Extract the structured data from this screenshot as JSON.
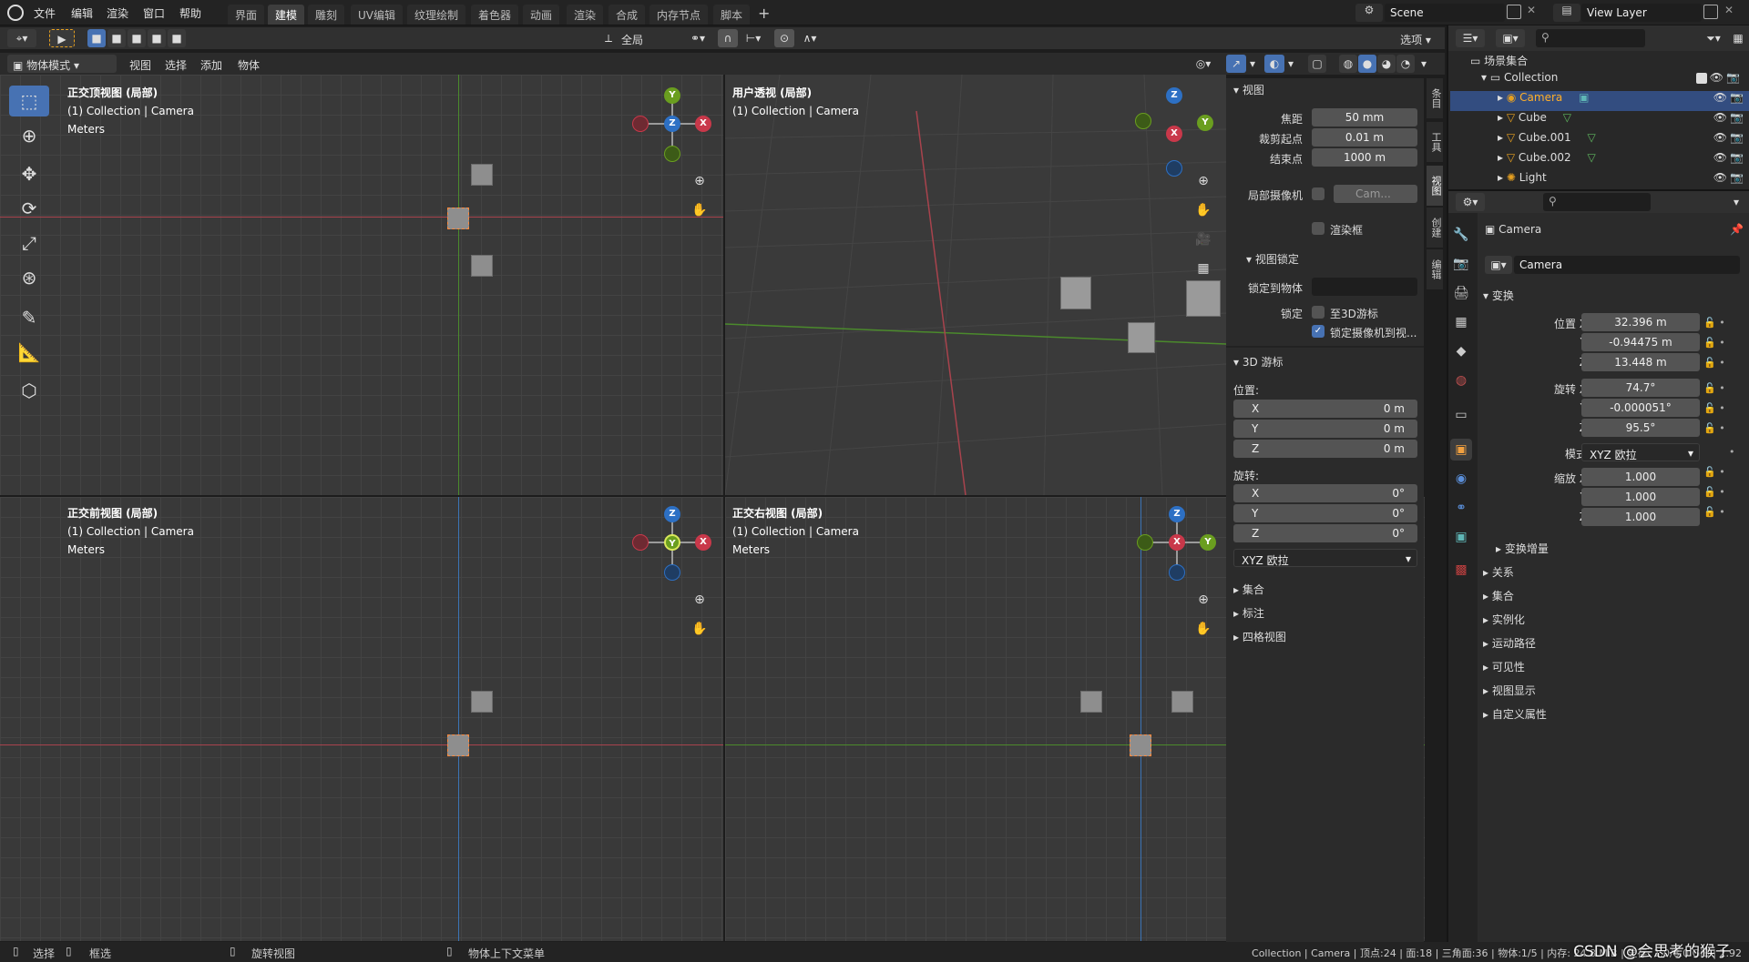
{
  "menu": {
    "items": [
      "文件",
      "编辑",
      "渲染",
      "窗口",
      "帮助"
    ]
  },
  "workspaces": [
    "界面",
    "建模",
    "雕刻",
    "UV编辑",
    "纹理绘制",
    "着色器",
    "动画",
    "渲染",
    "合成",
    "内存节点",
    "脚本"
  ],
  "workspace_add": "+",
  "scene": {
    "name": "Scene",
    "view_layer": "View Layer"
  },
  "viewport_header": {
    "mode": "物体模式",
    "menus": [
      "视图",
      "选择",
      "添加",
      "物体"
    ],
    "orientation": "全局",
    "options": "选项"
  },
  "viewports": {
    "top": {
      "title": "正交顶视图 (局部)",
      "collection": "(1) Collection | Camera",
      "units": "Meters"
    },
    "user": {
      "title": "用户透视 (局部)",
      "collection": "(1) Collection | Camera"
    },
    "front": {
      "title": "正交前视图 (局部)",
      "collection": "(1) Collection | Camera",
      "units": "Meters"
    },
    "right": {
      "title": "正交右视图 (局部)",
      "collection": "(1) Collection | Camera",
      "units": "Meters"
    }
  },
  "gizmo_labels": {
    "x": "X",
    "y": "Y",
    "z": "Z"
  },
  "npanel": {
    "view_header": "视图",
    "focal_label": "焦距",
    "focal_value": "50 mm",
    "clip_start_label": "裁剪起点",
    "clip_start_value": "0.01 m",
    "clip_end_label": "结束点",
    "clip_end_value": "1000 m",
    "local_camera_label": "局部摄像机",
    "local_camera_value": "Cam...",
    "render_region": "渲染框",
    "view_lock_header": "视图锁定",
    "lock_to_object_label": "锁定到物体",
    "lock_label": "锁定",
    "lock_3d_cursor": "至3D游标",
    "lock_camera_to_view": "锁定摄像机到视...",
    "cursor_header": "3D 游标",
    "location_label": "位置:",
    "rotation_label": "旋转:",
    "cursor_loc": [
      {
        "axis": "X",
        "value": "0 m"
      },
      {
        "axis": "Y",
        "value": "0 m"
      },
      {
        "axis": "Z",
        "value": "0 m"
      }
    ],
    "cursor_rot": [
      {
        "axis": "X",
        "value": "0°"
      },
      {
        "axis": "Y",
        "value": "0°"
      },
      {
        "axis": "Z",
        "value": "0°"
      }
    ],
    "rotation_mode": "XYZ 欧拉",
    "collections_header": "集合",
    "annotations_header": "标注",
    "quad_view_header": "四格视图"
  },
  "side_tabs": [
    "条目",
    "工具",
    "视图",
    "创建",
    "编辑"
  ],
  "outliner": {
    "root": "场景集合",
    "collection": "Collection",
    "items": [
      "Camera",
      "Cube",
      "Cube.001",
      "Cube.002",
      "Light"
    ]
  },
  "properties": {
    "object_name": "Camera",
    "name_field": "Camera",
    "transform_header": "变换",
    "location_label": "位置 X",
    "location": [
      "32.396 m",
      "-0.94475 m",
      "13.448 m"
    ],
    "rotation_label": "旋转 X",
    "rotation": [
      "74.7°",
      "-0.000051°",
      "95.5°"
    ],
    "mode_label": "模式",
    "mode_value": "XYZ 欧拉",
    "scale_label": "缩放 X",
    "scale": [
      "1.000",
      "1.000",
      "1.000"
    ],
    "y_label": "Y",
    "z_label": "Z",
    "delta_transform": "变换增量",
    "sections": [
      "关系",
      "集合",
      "实例化",
      "运动路径",
      "可见性",
      "视图显示",
      "自定义属性"
    ]
  },
  "status": {
    "select": "选择",
    "box_select": "框选",
    "rotate_view": "旋转视图",
    "context_menu": "物体上下文菜单",
    "stats": "Collection | Camera | 顶点:24 | 面:18 | 三角面:36 | 物体:1/5 | 内存: 24.8 MiB | 显存: 1.0/8.0 GiB | 2.92",
    "watermark": "CSDN @会思考的猴子"
  },
  "colors": {
    "accent": "#4772b3",
    "x_axis": "#c9384a",
    "y_axis": "#6a9e1f",
    "z_axis": "#2d70c4",
    "active_item": "#ffaf29"
  }
}
